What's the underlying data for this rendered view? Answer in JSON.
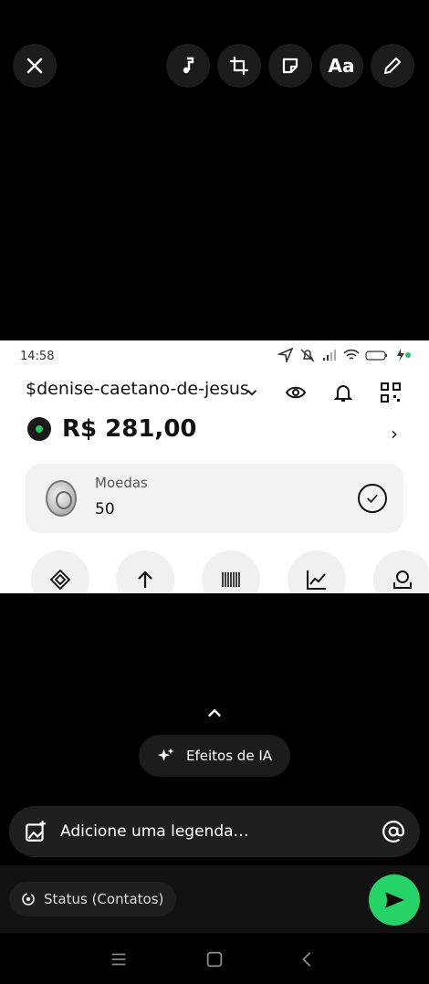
{
  "toolbar": {
    "close_icon": "close-icon",
    "music_icon": "music-note-icon",
    "crop_icon": "crop-rotate-icon",
    "sticker_icon": "sticker-icon",
    "text_label": "Aa",
    "draw_icon": "pencil-icon"
  },
  "shot": {
    "time": "14:58",
    "username": "$denise-caetano-de-jesus",
    "balance": "R$ 281,00",
    "coins_label": "Moedas",
    "coins_value": "50",
    "accent": "#22c55e"
  },
  "bottom": {
    "ai_effects_label": "Efeitos de IA",
    "caption_placeholder": "Adicione uma legenda…",
    "status_label": "Status (Contatos)",
    "send_color": "#25d366"
  }
}
